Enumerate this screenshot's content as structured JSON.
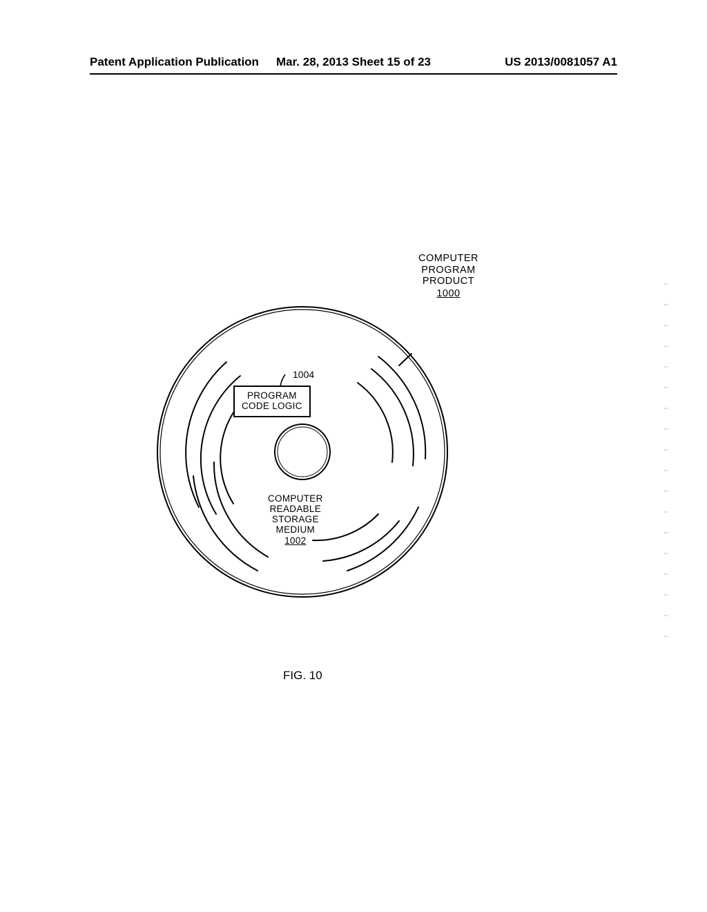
{
  "header": {
    "left": "Patent Application Publication",
    "center": "Mar. 28, 2013  Sheet 15 of 23",
    "right": "US 2013/0081057 A1"
  },
  "labels": {
    "product_line1": "COMPUTER",
    "product_line2": "PROGRAM",
    "product_line3": "PRODUCT",
    "product_ref": "1000",
    "box_line1": "PROGRAM",
    "box_line2": "CODE LOGIC",
    "box_ref": "1004",
    "medium_line1": "COMPUTER",
    "medium_line2": "READABLE",
    "medium_line3": "STORAGE",
    "medium_line4": "MEDIUM",
    "medium_ref": "1002",
    "figure_caption": "FIG. 10"
  }
}
